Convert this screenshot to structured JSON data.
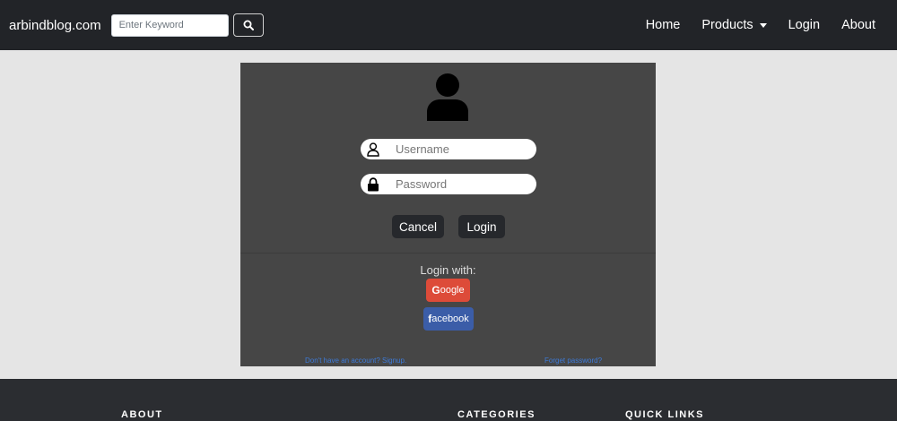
{
  "navbar": {
    "brand": "arbindblog.com",
    "search": {
      "placeholder": "Enter Keyword",
      "icon": "search-icon"
    },
    "links": [
      {
        "label": "Home"
      },
      {
        "label": "Products",
        "dropdown": true
      },
      {
        "label": "Login"
      },
      {
        "label": "About"
      }
    ]
  },
  "login": {
    "avatar_icon": "user-icon",
    "username": {
      "placeholder": "Username",
      "icon": "user-outline-icon"
    },
    "password": {
      "placeholder": "Password",
      "icon": "lock-icon"
    },
    "cancel_label": "Cancel",
    "login_label": "Login",
    "login_with": "Login with:",
    "google": {
      "prefix": "G",
      "rest": "oogle",
      "color": "#dd4b39"
    },
    "facebook": {
      "prefix": "f",
      "rest": "acebook",
      "color": "#3b5da8"
    },
    "signup_link": "Don't have an account? Signup.",
    "forgot_link": "Forget password?"
  },
  "footer": {
    "headings": [
      "ABOUT",
      "CATEGORIES",
      "QUICK LINKS"
    ]
  },
  "colors": {
    "navbar_bg": "#222428",
    "panel_bg": "#464646",
    "link": "#3d7bd9"
  }
}
